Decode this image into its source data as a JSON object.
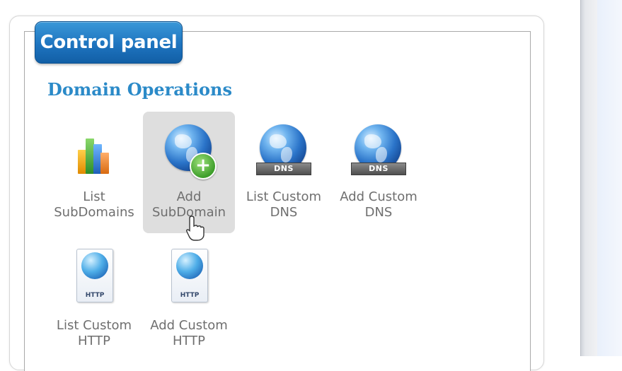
{
  "panel": {
    "title": "Control panel",
    "section_title": "Domain Operations"
  },
  "tiles": [
    {
      "line1": "List",
      "line2": "SubDomains",
      "icon": "bar-chart-icon"
    },
    {
      "line1": "Add",
      "line2": "SubDomain",
      "icon": "globe-add-icon"
    },
    {
      "line1": "List Custom",
      "line2": "DNS",
      "icon": "globe-dns-icon",
      "badge": "DNS"
    },
    {
      "line1": "Add Custom",
      "line2": "DNS",
      "icon": "globe-dns-icon",
      "badge": "DNS"
    },
    {
      "line1": "List Custom",
      "line2": "HTTP",
      "icon": "http-page-icon",
      "badge": "HTTP"
    },
    {
      "line1": "Add Custom",
      "line2": "HTTP",
      "icon": "http-page-icon",
      "badge": "HTTP"
    }
  ],
  "colors": {
    "tab_blue": "#1e74bf",
    "section_title": "#2b8ac8",
    "label_gray": "#6f6f6f",
    "hover_tile": "#dedede"
  }
}
